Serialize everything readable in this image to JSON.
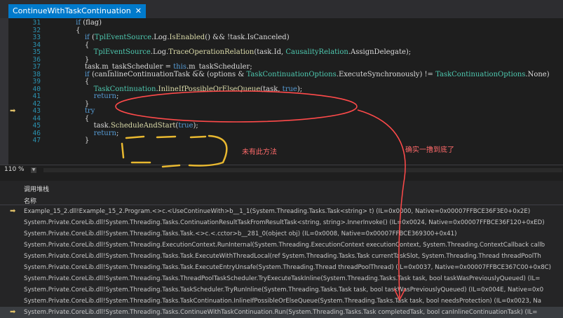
{
  "tab": {
    "title": "ContinueWithTaskContinuation",
    "close": "✕"
  },
  "editor": {
    "lines": [
      {
        "n": "31",
        "t": "            if (flag)"
      },
      {
        "n": "32",
        "t": "            {"
      },
      {
        "n": "33",
        "t": "                if (TplEventSource.Log.IsEnabled() && !task.IsCanceled)"
      },
      {
        "n": "34",
        "t": "                {"
      },
      {
        "n": "35",
        "t": "                    TplEventSource.Log.TraceOperationRelation(task.Id, CausalityRelation.AssignDelegate);"
      },
      {
        "n": "36",
        "t": "                }"
      },
      {
        "n": "37",
        "t": "                task.m_taskScheduler = this.m_taskScheduler;"
      },
      {
        "n": "38",
        "t": "                if (canInlineContinuationTask && (options & TaskContinuationOptions.ExecuteSynchronously) != TaskContinuationOptions.None)"
      },
      {
        "n": "39",
        "t": "                {"
      },
      {
        "n": "40",
        "t": "                    TaskContinuation.InlineIfPossibleOrElseQueue(task, true);"
      },
      {
        "n": "41",
        "t": "                    return;"
      },
      {
        "n": "42",
        "t": "                }"
      },
      {
        "n": "43",
        "t": "                try"
      },
      {
        "n": "44",
        "t": "                {"
      },
      {
        "n": "45",
        "t": "                    task.ScheduleAndStart(true);"
      },
      {
        "n": "46",
        "t": "                    return;"
      },
      {
        "n": "47",
        "t": "                }"
      }
    ],
    "annotation_not_exist": "未有此方法",
    "annotation_bottom": "确实一撸到底了"
  },
  "status": {
    "zoom": "110 %"
  },
  "callstack": {
    "title": "调用堆栈",
    "column": "名称",
    "rows": [
      "Example_15_2.dll!Example_15_2.Program.<>c.<UseContinueWith>b__1_1(System.Threading.Tasks.Task<string> t) (IL=0x0000, Native=0x00007FFBCE36F3E0+0x2E)",
      "System.Private.CoreLib.dll!System.Threading.Tasks.ContinuationResultTaskFromResultTask<string, string>.InnerInvoke() (IL=0x0024, Native=0x00007FFBCE36F120+0xED)",
      "System.Private.CoreLib.dll!System.Threading.Tasks.Task.<>c.<.cctor>b__281_0(object obj) (IL=0x0008, Native=0x00007FFBCE369300+0x41)",
      "System.Private.CoreLib.dll!System.Threading.ExecutionContext.RunInternal(System.Threading.ExecutionContext executionContext, System.Threading.ContextCallback callb",
      "System.Private.CoreLib.dll!System.Threading.Tasks.Task.ExecuteWithThreadLocal(ref System.Threading.Tasks.Task currentTaskSlot, System.Threading.Thread threadPoolTh",
      "System.Private.CoreLib.dll!System.Threading.Tasks.Task.ExecuteEntryUnsafe(System.Threading.Thread threadPoolThread) (IL=0x0037, Native=0x00007FFBCE367C00+0x8C)",
      "System.Private.CoreLib.dll!System.Threading.Tasks.ThreadPoolTaskScheduler.TryExecuteTaskInline(System.Threading.Tasks.Task task, bool taskWasPreviouslyQueued) (IL=",
      "System.Private.CoreLib.dll!System.Threading.Tasks.TaskScheduler.TryRunInline(System.Threading.Tasks.Task task, bool taskWasPreviouslyQueued) (IL=0x004E, Native=0x0",
      "System.Private.CoreLib.dll!System.Threading.Tasks.TaskContinuation.InlineIfPossibleOrElseQueue(System.Threading.Tasks.Task task, bool needsProtection) (IL=0x0023, Na",
      "System.Private.CoreLib.dll!System.Threading.Tasks.ContinueWithTaskContinuation.Run(System.Threading.Tasks.Task completedTask, bool canInlineContinuationTask) (IL="
    ]
  },
  "colors": {
    "accent": "#007acc",
    "annotation": "#ff4a4a",
    "linenumber": "#2b91af"
  },
  "icons": {
    "current_line": "arrow-right-icon",
    "current_frame": "arrow-right-icon"
  }
}
